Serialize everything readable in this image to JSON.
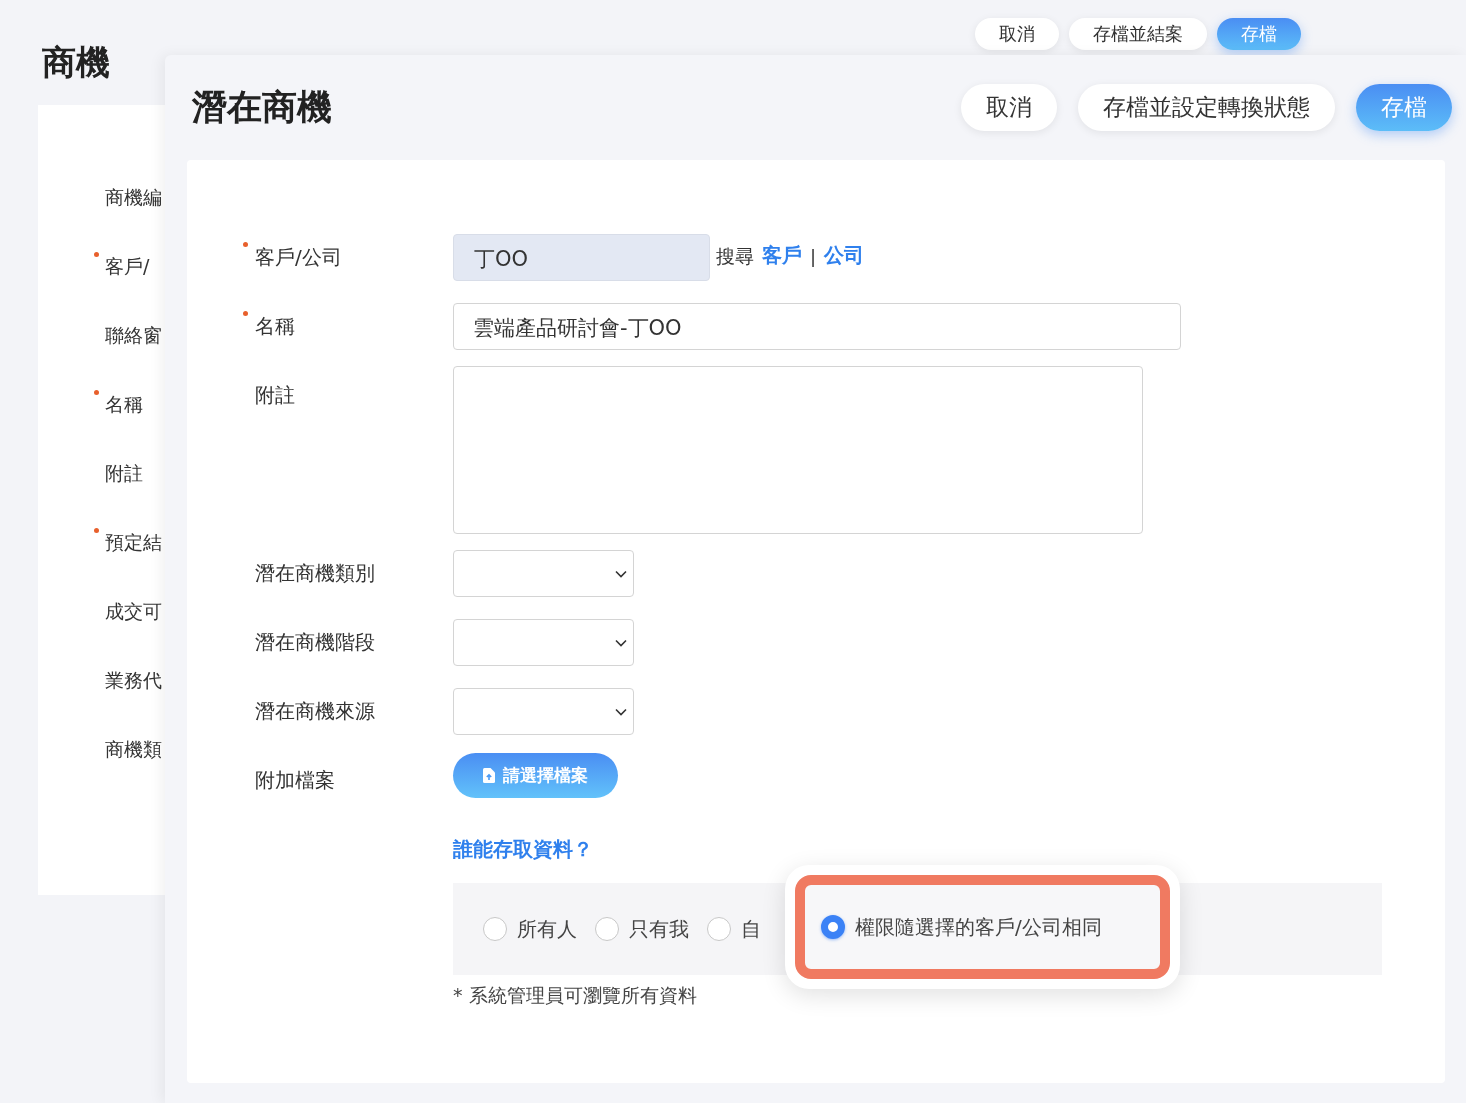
{
  "background_page": {
    "title": "商機",
    "buttons": [
      {
        "label": "取消",
        "kind": "secondary"
      },
      {
        "label": "存檔並結案",
        "kind": "secondary"
      },
      {
        "label": "存檔",
        "kind": "primary"
      }
    ],
    "form_labels": [
      {
        "label": "商機編",
        "required": false
      },
      {
        "label": "客戶/",
        "required": true
      },
      {
        "label": "聯絡窗",
        "required": false
      },
      {
        "label": "名稱",
        "required": true
      },
      {
        "label": "附註",
        "required": false
      },
      {
        "label": "預定結",
        "required": true
      },
      {
        "label": "成交可",
        "required": false
      },
      {
        "label": "業務代",
        "required": false
      },
      {
        "label": "商機類",
        "required": false
      }
    ]
  },
  "dialog": {
    "title": "潛在商機",
    "buttons": [
      {
        "label": "取消",
        "kind": "secondary"
      },
      {
        "label": "存檔並設定轉換狀態",
        "kind": "secondary"
      },
      {
        "label": "存檔",
        "kind": "primary"
      }
    ],
    "fields": [
      {
        "kind": "lookup",
        "label": "客戶/公司",
        "required": true,
        "value": "丁OO",
        "search_label": "搜尋",
        "links": [
          "客戶",
          "公司"
        ],
        "separator": "|"
      },
      {
        "kind": "text",
        "label": "名稱",
        "required": true,
        "value": "雲端產品研討會-丁OO"
      },
      {
        "kind": "textarea",
        "label": "附註",
        "required": false
      },
      {
        "kind": "select",
        "label": "潛在商機類別",
        "required": false
      },
      {
        "kind": "select",
        "label": "潛在商機階段",
        "required": false
      },
      {
        "kind": "select",
        "label": "潛在商機來源",
        "required": false
      },
      {
        "kind": "file",
        "label": "附加檔案",
        "required": false,
        "button": "請選擇檔案"
      }
    ],
    "access": {
      "question": "誰能存取資料？",
      "options": [
        {
          "label": "所有人",
          "selected": false,
          "highlighted": false
        },
        {
          "label": "只有我",
          "selected": false,
          "highlighted": false
        },
        {
          "label": "自",
          "selected": false,
          "highlighted": false
        },
        {
          "label": "權限隨選擇的客戶/公司相同",
          "selected": true,
          "highlighted": true
        }
      ],
      "note": "* 系統管理員可瀏覽所有資料"
    }
  }
}
